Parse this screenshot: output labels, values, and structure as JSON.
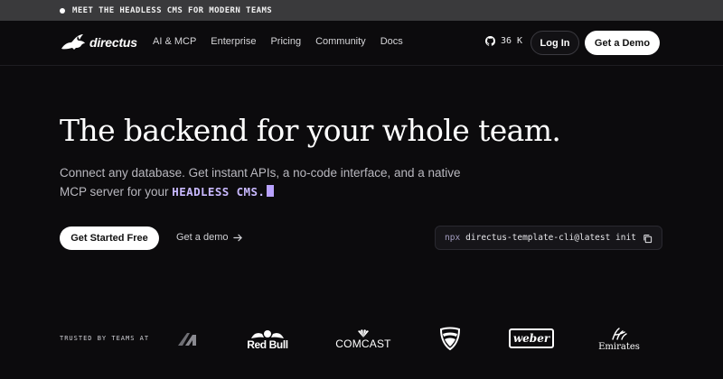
{
  "announcement": {
    "text": "MEET THE HEADLESS CMS FOR MODERN TEAMS"
  },
  "nav": {
    "brand": "directus",
    "links": [
      "AI & MCP",
      "Enterprise",
      "Pricing",
      "Community",
      "Docs"
    ],
    "github_stars": "36 K",
    "login_label": "Log In",
    "demo_label": "Get a Demo"
  },
  "hero": {
    "title": "The backend for your whole team.",
    "subtitle_prefix": "Connect any database. Get instant APIs, a no-code interface, and a native MCP server for your",
    "subtitle_highlight": "HEADLESS CMS.",
    "primary_cta": "Get Started Free",
    "secondary_cta": "Get a demo",
    "cli_prefix": "npx",
    "cli_command": "directus-template-cli@latest init"
  },
  "trusted": {
    "label": "TRUSTED BY TEAMS AT",
    "logos": {
      "redbull": "Red Bull",
      "comcast": "COMCAST",
      "weber": "weber",
      "emirates": "Emirates"
    }
  },
  "colors": {
    "background": "#0c0b0d",
    "announce_bar": "#3a3a3c",
    "highlight": "#c9b9ff",
    "cursor": "#b9a2ff"
  },
  "icons": {
    "brand": "rabbit-logo-icon",
    "github": "github-icon",
    "arrow": "arrow-right-icon",
    "copy": "copy-icon"
  }
}
